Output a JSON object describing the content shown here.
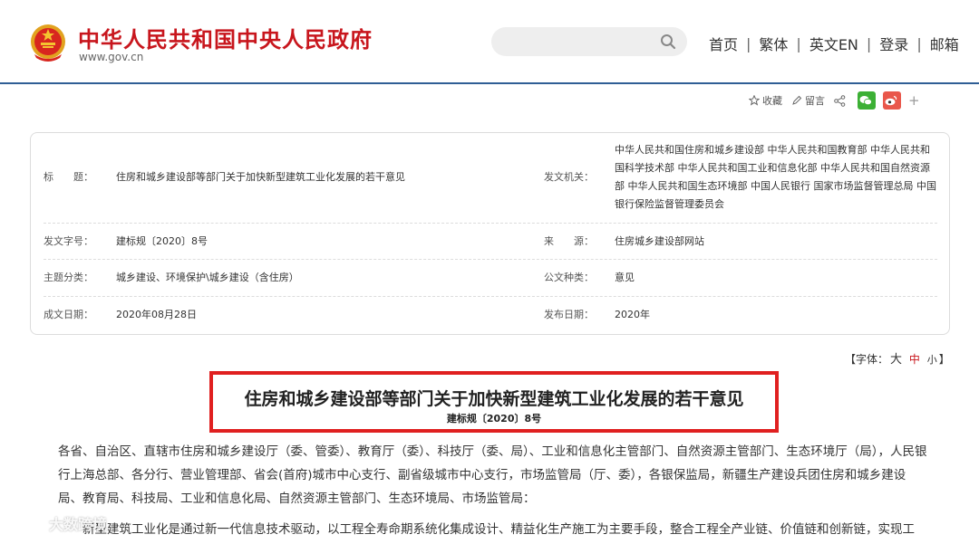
{
  "header": {
    "site_title": "中华人民共和国中央人民政府",
    "site_url": "www.gov.cn",
    "search_placeholder": "",
    "nav": [
      {
        "label": "首页"
      },
      {
        "label": "繁体"
      },
      {
        "label": "英文EN"
      },
      {
        "label": "登录"
      },
      {
        "label": "邮箱"
      }
    ]
  },
  "share": {
    "favorite": "收藏",
    "comment": "留言",
    "more": "+"
  },
  "info": {
    "title_label": "标　　题：",
    "title_value": "住房和城乡建设部等部门关于加快新型建筑工业化发展的若干意见",
    "issuer_label": "发文机关：",
    "issuer_value": "中华人民共和国住房和城乡建设部 中华人民共和国教育部 中华人民共和国科学技术部 中华人民共和国工业和信息化部 中华人民共和国自然资源部 中华人民共和国生态环境部 中国人民银行 国家市场监督管理总局 中国银行保险监督管理委员会",
    "doc_no_label": "发文字号：",
    "doc_no_value": "建标规〔2020〕8号",
    "source_label": "来　　源：",
    "source_value": "住房城乡建设部网站",
    "category_label": "主题分类：",
    "category_value": "城乡建设、环境保护\\城乡建设（含住房）",
    "type_label": "公文种类：",
    "type_value": "意见",
    "written_label": "成文日期：",
    "written_value": "2020年08月28日",
    "published_label": "发布日期：",
    "published_value": "2020年"
  },
  "fontsize": {
    "prefix": "【字体：",
    "large": "大",
    "medium": "中",
    "small": "小",
    "suffix": "】"
  },
  "article": {
    "title": "住房和城乡建设部等部门关于加快新型建筑工业化发展的若干意见",
    "number": "建标规〔2020〕8号",
    "paragraph1": "各省、自治区、直辖市住房和城乡建设厅（委、管委）、教育厅（委）、科技厅（委、局）、工业和信息化主管部门、自然资源主管部门、生态环境厅（局），人民银行上海总部、各分行、营业管理部、省会(首府)城市中心支行、副省级城市中心支行，市场监管局（厅、委），各银保监局，新疆生产建设兵团住房和城乡建设局、教育局、科技局、工业和信息化局、自然资源主管部门、生态环境局、市场监管局：",
    "paragraph2": "新型建筑工业化是通过新一代信息技术驱动，以工程全寿命期系统化集成设计、精益化生产施工为主要手段，整合工程全产业链、价值链和创新链，实现工"
  },
  "watermark": {
    "text": "大数跨境"
  },
  "colors": {
    "brand_red": "#c8161d",
    "header_line": "#2f5e95",
    "title_border": "#e02020",
    "wechat": "#3cb035",
    "weibo": "#e9574b"
  }
}
